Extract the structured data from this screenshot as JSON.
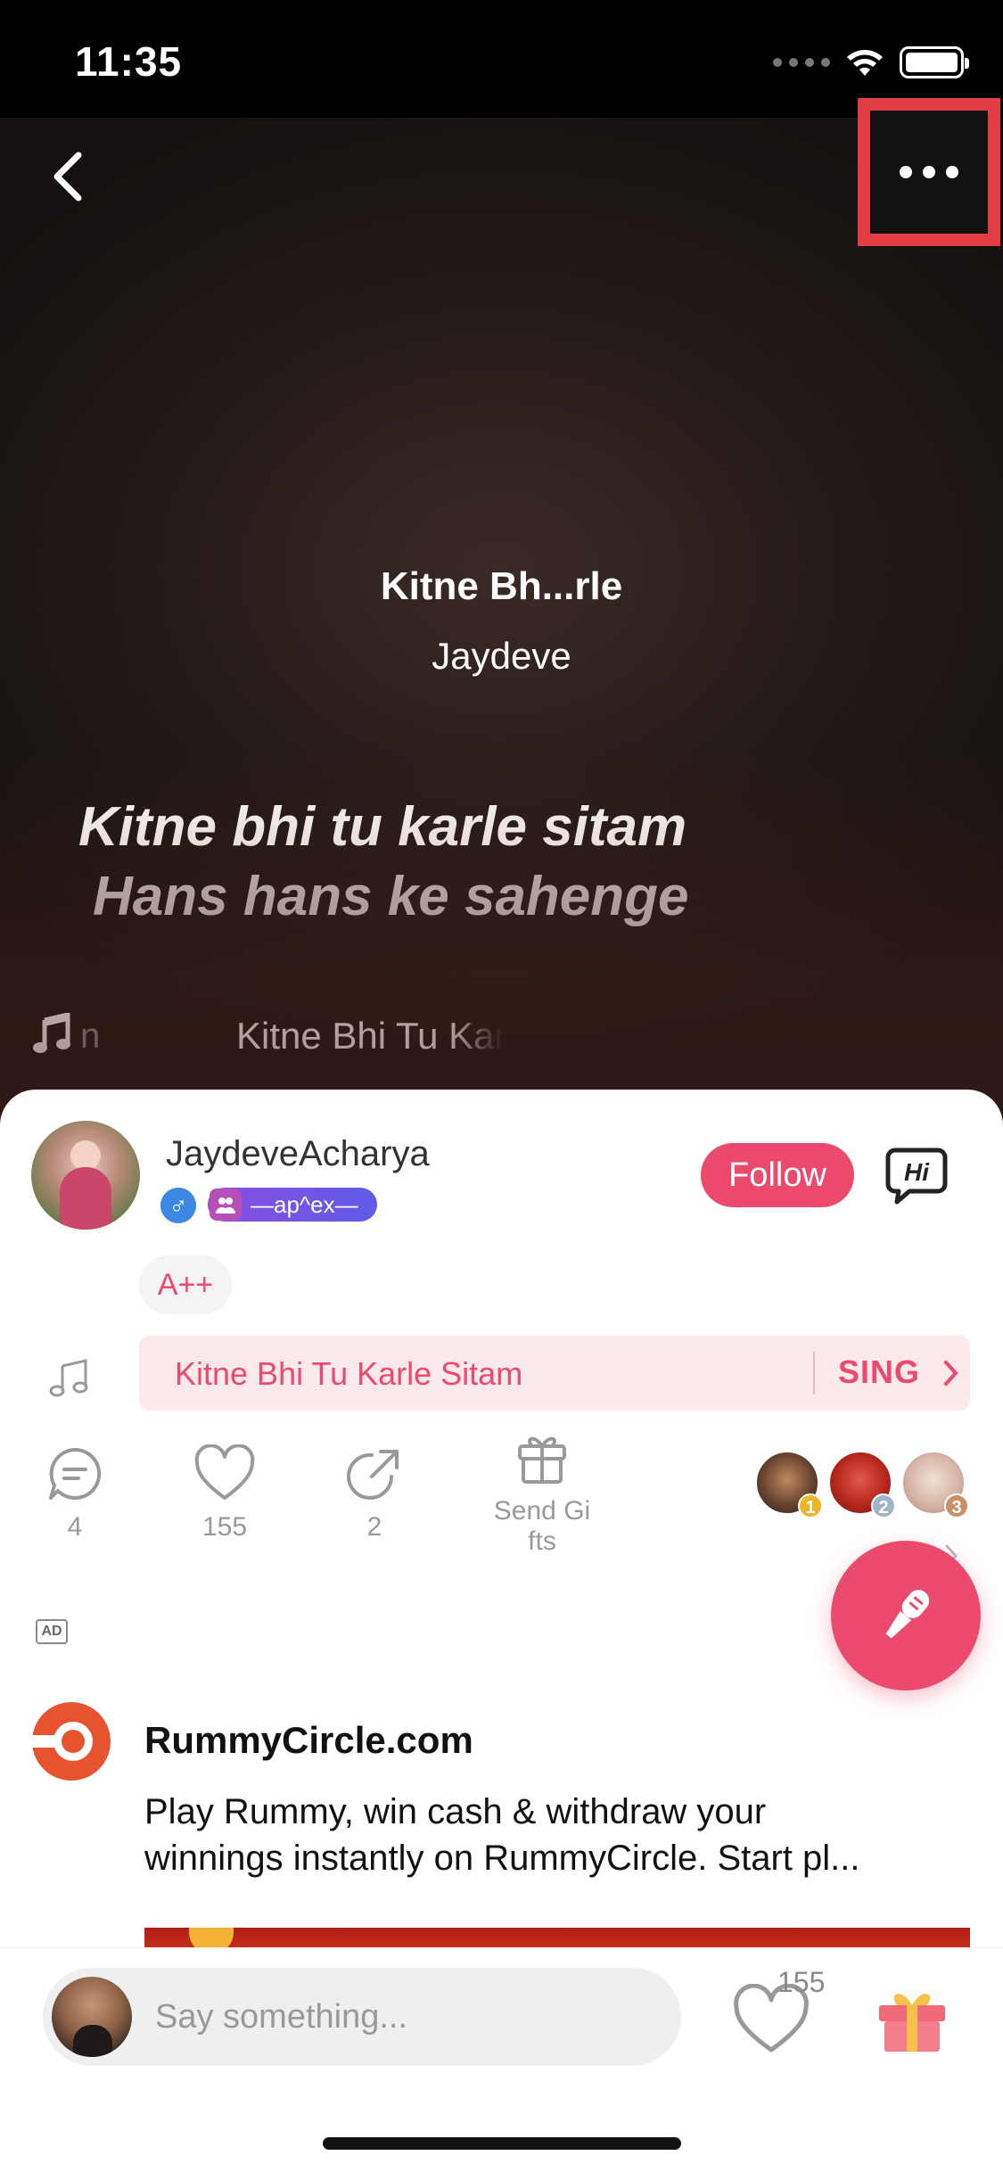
{
  "status_bar": {
    "time": "11:35"
  },
  "player": {
    "song_title": "Kitne Bh...rle",
    "artist": "Jaydeve",
    "lyric_current": "Kitne bhi tu karle sitam",
    "lyric_next": "Hans hans ke sahenge",
    "scroll_left": "n",
    "scroll_text": "Kitne Bhi Tu Karle Sitam",
    "icons": [
      "back-icon",
      "more-icon",
      "music-note-icon"
    ]
  },
  "profile": {
    "username": "JaydeveAcharya",
    "gender_symbol": "♂",
    "family_name": "—ap^ex—",
    "follow_label": "Follow",
    "hi_label": "Hi",
    "grade": "A++"
  },
  "song_bar": {
    "title": "Kitne Bhi Tu Karle Sitam",
    "sing_label": "SING"
  },
  "actions": [
    {
      "name": "comments",
      "icon": "comment-icon",
      "label": "4"
    },
    {
      "name": "likes",
      "icon": "heart-icon",
      "label": "155"
    },
    {
      "name": "shares",
      "icon": "share-icon",
      "label": "2"
    },
    {
      "name": "gifts",
      "icon": "gift-icon",
      "label": "Send Gi fts"
    }
  ],
  "top_fans": [
    {
      "rank": "1",
      "color": "#f0b429"
    },
    {
      "rank": "2",
      "color": "#9fb4c8"
    },
    {
      "rank": "3",
      "color": "#c9906a"
    }
  ],
  "ad": {
    "badge": "AD",
    "title": "RummyCircle.com",
    "text_line1": "Play Rummy, win cash & withdraw your",
    "text_line2": "winnings instantly on RummyCircle. Start pl..."
  },
  "bottom_bar": {
    "placeholder": "Say something...",
    "like_count": "155"
  },
  "colors": {
    "accent": "#ec4a6c",
    "highlight_box": "#e23c44",
    "ad_brand": "#e8532f"
  }
}
